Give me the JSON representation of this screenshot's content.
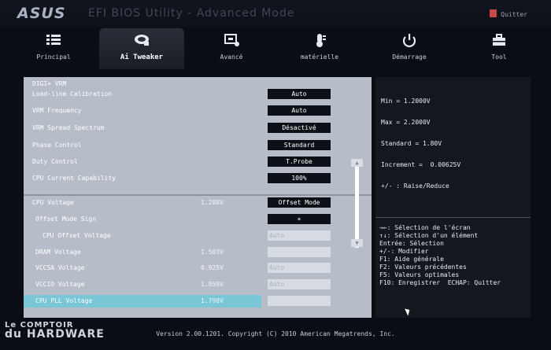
{
  "header": {
    "brand": "ASUS",
    "title": "EFI BIOS Utility - Advanced Mode",
    "quit_label": "Quitter"
  },
  "tabs": [
    {
      "label": "Principal",
      "icon": "list-icon"
    },
    {
      "label": "Ai Tweaker",
      "icon": "fan-icon",
      "active": true
    },
    {
      "label": "Avancé",
      "icon": "chip-icon"
    },
    {
      "label": "matérielle",
      "icon": "thermometer-icon"
    },
    {
      "label": "Démarrage",
      "icon": "power-icon"
    },
    {
      "label": "Tool",
      "icon": "toolbox-icon"
    }
  ],
  "settings": {
    "section": "DIGI+ VRM",
    "rows": [
      {
        "label": "Load-line Calibration",
        "value": "Auto"
      },
      {
        "label": "VRM Frequency",
        "value": "Auto"
      },
      {
        "label": "VRM Spread Spectrum",
        "value": "Désactivé"
      },
      {
        "label": "Phase Control",
        "value": "Standard"
      },
      {
        "label": "Duty Control",
        "value": "T.Probe"
      },
      {
        "label": "CPU Current Capability",
        "value": "100%"
      }
    ],
    "voltage_rows": [
      {
        "label": "CPU Voltage",
        "reading": "1.208V",
        "value": "Offset Mode"
      },
      {
        "label": "Offset Mode Sign",
        "reading": "",
        "value": "+"
      },
      {
        "label": "CPU Offset Voltage",
        "reading": "",
        "value": "Auto"
      },
      {
        "label": "DRAM Voltage",
        "reading": "1.503V",
        "value": ""
      },
      {
        "label": "VCCSA Voltage",
        "reading": "0.925V",
        "value": "Auto"
      },
      {
        "label": "VCCIO Voltage",
        "reading": "1.059V",
        "value": "Auto"
      },
      {
        "label": "CPU PLL Voltage",
        "reading": "1.798V",
        "value": ""
      }
    ]
  },
  "info": {
    "lines": [
      "Min = 1.2000V",
      "Max = 2.2000V",
      "Standard = 1.80V",
      "Increment =  0.00625V",
      "+/- : Raise/Reduce"
    ]
  },
  "help": {
    "lines": [
      "→←: Sélection de l'écran",
      "↑↓: Sélection d'un élément",
      "Entrée: Sélection",
      "+/-: Modifier",
      "F1: Aide générale",
      "F2: Valeurs précédentes",
      "F5: Valeurs optimales",
      "F10: Enregistrer  ECHAP: Quitter"
    ]
  },
  "footer": "Version 2.00.1201. Copyright (C) 2010 American Megatrends, Inc.",
  "watermark": {
    "line1": "Le COMPTOIR",
    "line2": "du HARDWARE"
  },
  "colors": {
    "accent": "#78c6d6",
    "panel": "#b7bdc8",
    "value_box": "#0c0f16"
  }
}
